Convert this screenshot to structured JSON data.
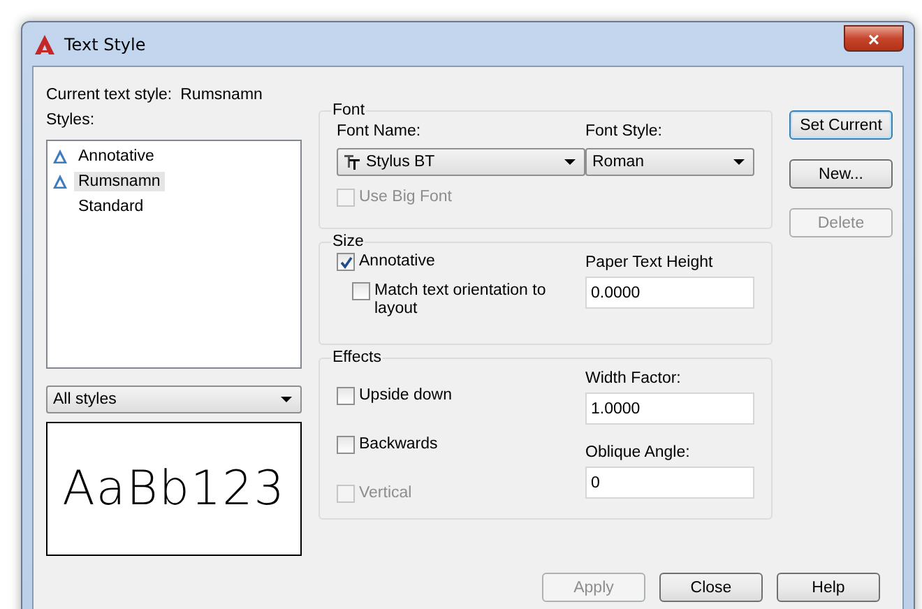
{
  "window": {
    "title": "Text Style",
    "close": "×"
  },
  "current_style": {
    "label": "Current text style:",
    "value": "Rumsnamn"
  },
  "styles": {
    "label": "Styles:",
    "items": [
      {
        "name": "Annotative",
        "annotative": true,
        "selected": false
      },
      {
        "name": "Rumsnamn",
        "annotative": true,
        "selected": true
      },
      {
        "name": "Standard",
        "annotative": false,
        "selected": false
      }
    ]
  },
  "filter": {
    "value": "All styles"
  },
  "preview": {
    "text": "AaBb123"
  },
  "font": {
    "title": "Font",
    "font_name": {
      "label": "Font Name:",
      "value": "Stylus BT"
    },
    "font_style": {
      "label": "Font Style:",
      "value": "Roman"
    },
    "big_font": {
      "label": "Use Big Font",
      "checked": false,
      "disabled": true
    }
  },
  "size": {
    "title": "Size",
    "annotative": {
      "label": "Annotative",
      "checked": true,
      "disabled": false
    },
    "match": {
      "label": "Match text orientation to layout",
      "checked": false,
      "disabled": false
    },
    "paper_height": {
      "label": "Paper Text Height",
      "value": "0.0000"
    }
  },
  "effects": {
    "title": "Effects",
    "options": [
      {
        "label": "Upside down",
        "checked": false,
        "disabled": false
      },
      {
        "label": "Backwards",
        "checked": false,
        "disabled": false
      },
      {
        "label": "Vertical",
        "checked": false,
        "disabled": true
      }
    ],
    "width_factor": {
      "label": "Width Factor:",
      "value": "1.0000"
    },
    "oblique": {
      "label": "Oblique Angle:",
      "value": "0"
    }
  },
  "side_buttons": [
    {
      "label": "Set Current",
      "disabled": false,
      "default": true
    },
    {
      "label": "New...",
      "disabled": false,
      "default": false
    },
    {
      "label": "Delete",
      "disabled": true,
      "default": false
    }
  ],
  "bottom_buttons": [
    {
      "label": "Apply",
      "disabled": true,
      "default": false
    },
    {
      "label": "Close",
      "disabled": false,
      "default": false
    },
    {
      "label": "Help",
      "disabled": false,
      "default": false
    }
  ]
}
